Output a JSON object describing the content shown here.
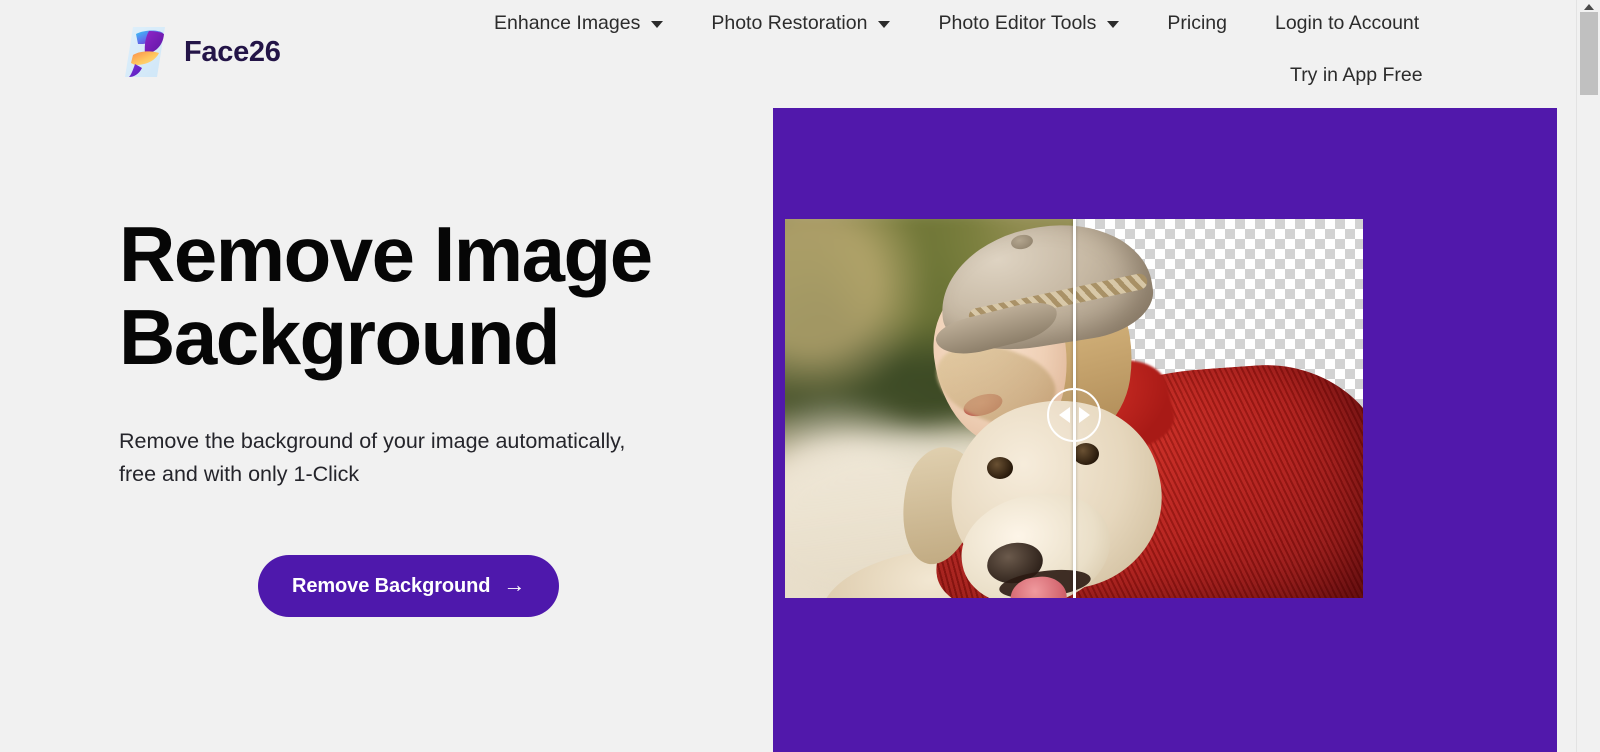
{
  "header": {
    "brand": {
      "name": "Face26",
      "logo_icon": "face26-leaf-logo"
    },
    "nav": [
      {
        "label": "Enhance Images",
        "has_dropdown": true,
        "icon": "chevron-down-icon"
      },
      {
        "label": "Photo Restoration",
        "has_dropdown": true,
        "icon": "chevron-down-icon"
      },
      {
        "label": "Photo Editor Tools",
        "has_dropdown": true,
        "icon": "chevron-down-icon"
      },
      {
        "label": "Pricing",
        "has_dropdown": false
      },
      {
        "label": "Login to Account",
        "has_dropdown": false
      }
    ],
    "secondary_link": "Try in App Free"
  },
  "hero": {
    "title": "Remove Image\nBackground",
    "subtitle": "Remove the background of your image automatically,\nfree and with only 1-Click",
    "cta_label": "Remove Background",
    "cta_arrow": "→"
  },
  "compare": {
    "before_alt": "woman in beret hugging a yellow labrador on a blurred autumn forest path",
    "after_alt": "same subject cut out on a transparency checkerboard",
    "handle_left_icon": "arrow-left-icon",
    "handle_right_icon": "arrow-right-icon"
  },
  "scrollbar": {
    "up_arrow_icon": "scroll-up-arrow-icon",
    "thumb_label": "vertical-scroll-thumb"
  },
  "colors": {
    "page_background": "#f1f1f1",
    "panel_purple": "#5118ab",
    "button_purple": "#4e18ac",
    "heading_text": "#060606",
    "body_text": "#25252b",
    "nav_text": "#2c2c2c",
    "brand_text": "#231447",
    "divider_white": "#ffffff",
    "checker_gray": "#d2d2d2",
    "scroll_thumb": "#c0c0c0"
  }
}
